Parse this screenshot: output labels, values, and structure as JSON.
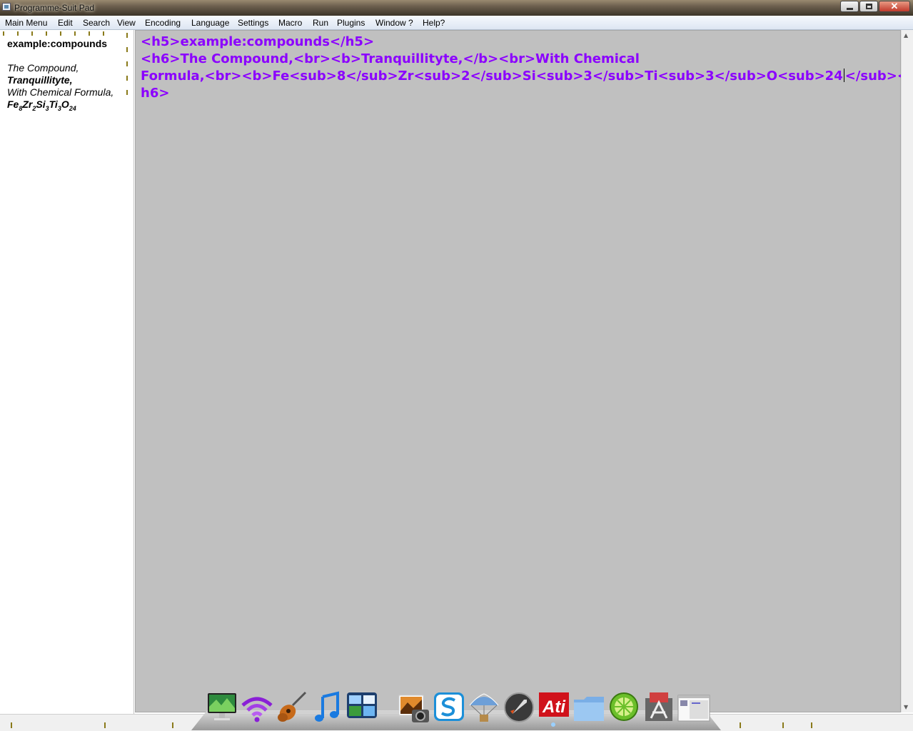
{
  "window": {
    "title": "Programme-Suit Pad"
  },
  "menu": [
    "Main Menu",
    "Edit",
    "Search",
    "View",
    "Encoding",
    "Language",
    "Settings",
    "Macro",
    "Run",
    "Plugins",
    "Window ?",
    "Help?"
  ],
  "preview": {
    "heading": "example:compounds",
    "line1": "The Compound,",
    "line2": "Tranquillityte,",
    "line3": "With Chemical Formula,",
    "formula": [
      {
        "el": "Fe",
        "sub": "8"
      },
      {
        "el": "Zr",
        "sub": "2"
      },
      {
        "el": "Si",
        "sub": "3"
      },
      {
        "el": "Ti",
        "sub": "3"
      },
      {
        "el": "O",
        "sub": "24"
      }
    ]
  },
  "editor": {
    "lines": [
      "<h5>example:compounds</h5>",
      "<h6>The Compound,<br><b>Tranquillityte,</b><br>With Chemical",
      "Formula,<br><b>Fe<sub>8</sub>Zr<sub>2</sub>Si<sub>3</sub>Ti<sub>3</sub>O<sub>24",
      "</sub></b></",
      "h6>"
    ],
    "text_color": "#8b00ff",
    "background": "#c0c0c0"
  },
  "dock": {
    "icons": [
      "monitor-icon",
      "wifi-icon",
      "guitar-icon",
      "music-note-icon",
      "dashboard-icon",
      "photo-camera-icon",
      "logo-s-icon",
      "parachute-icon",
      "rocket-icon",
      "ati-logo-icon",
      "folder-icon",
      "lime-icon",
      "app-store-icon",
      "window-thumbnail-icon"
    ],
    "ati_text": "Ati"
  }
}
